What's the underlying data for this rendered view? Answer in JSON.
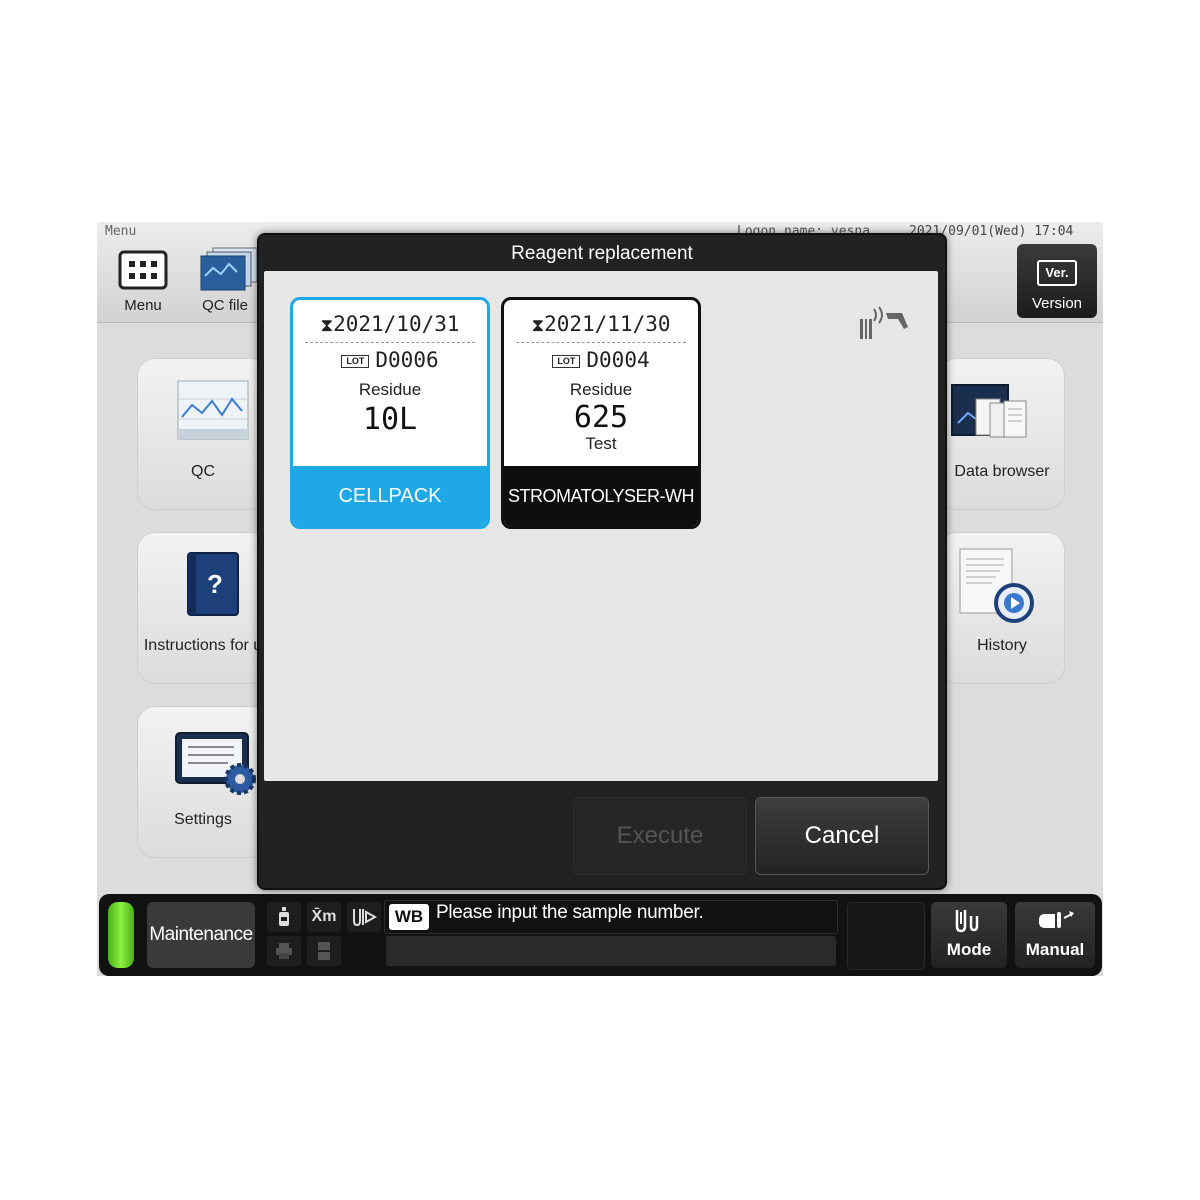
{
  "header": {
    "menu_title": "Menu",
    "logon": "Logon name: vesna",
    "datetime": "2021/09/01(Wed) 17:04",
    "buttons": {
      "menu_label": "Menu",
      "qc_file_label": "QC file",
      "version_label": "Version",
      "version_badge": "Ver."
    }
  },
  "tiles": {
    "qc": "QC",
    "instructions": "Instructions for u",
    "settings": "Settings",
    "data_browser": "Data browser",
    "history": "History"
  },
  "dialog": {
    "title": "Reagent replacement",
    "reagents": [
      {
        "expiry": "2021/10/31",
        "lot_badge": "LOT",
        "lot": "D0006",
        "residue_label": "Residue",
        "residue_value": "10L",
        "unit": "",
        "name": "CELLPACK",
        "color": "#1ea8e6",
        "selected": true
      },
      {
        "expiry": "2021/11/30",
        "lot_badge": "LOT",
        "lot": "D0004",
        "residue_label": "Residue",
        "residue_value": "625",
        "unit": "Test",
        "name": "STROMATOLYSER-WH",
        "color": "#0e0e0e",
        "selected": false
      }
    ],
    "execute_label": "Execute",
    "cancel_label": "Cancel",
    "scanner_icon": "barcode-scanner-icon"
  },
  "statusbar": {
    "status_label": "Maintenance",
    "status_color": "#6cd82c",
    "mode_tag": "WB",
    "message": "Please input the sample number.",
    "xm_label": "X̄m",
    "mode_label": "Mode",
    "manual_label": "Manual"
  }
}
